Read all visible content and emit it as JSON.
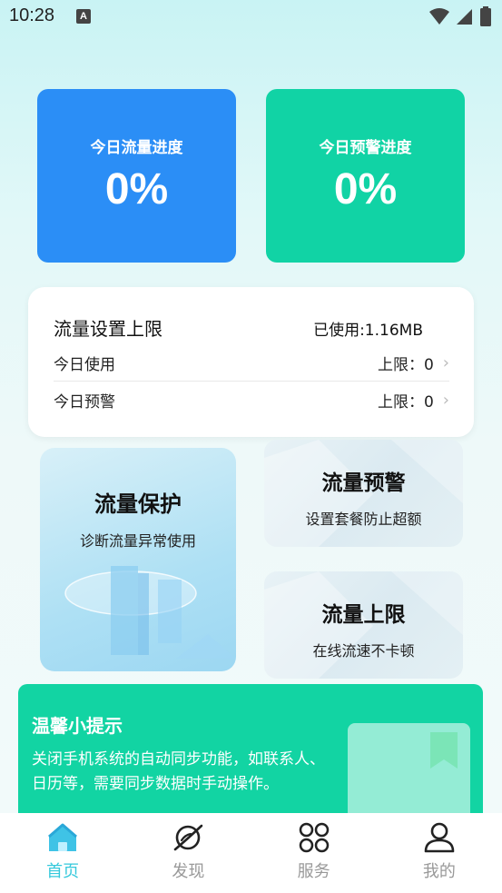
{
  "status_bar": {
    "time": "10:28",
    "notif_letter": "A"
  },
  "progress_cards": [
    {
      "title": "今日流量进度",
      "value": "0%"
    },
    {
      "title": "今日预警进度",
      "value": "0%"
    }
  ],
  "limit_panel": {
    "title": "流量设置上限",
    "used": "已使用:1.16MB",
    "rows": [
      {
        "label": "今日使用",
        "value": "上限：0"
      },
      {
        "label": "今日预警",
        "value": "上限：0"
      }
    ]
  },
  "features": {
    "protect": {
      "title": "流量保护",
      "sub": "诊断流量异常使用"
    },
    "warning": {
      "title": "流量预警",
      "sub": "设置套餐防止超额"
    },
    "limit": {
      "title": "流量上限",
      "sub": "在线流速不卡顿"
    }
  },
  "tips": {
    "title": "温馨小提示",
    "text": "关闭手机系统的自动同步功能，如联系人、日历等，需要同步数据时手动操作。"
  },
  "nav": [
    {
      "label": "首页",
      "icon": "home-icon",
      "active": true
    },
    {
      "label": "发现",
      "icon": "planet-icon",
      "active": false
    },
    {
      "label": "服务",
      "icon": "grid-icon",
      "active": false
    },
    {
      "label": "我的",
      "icon": "user-icon",
      "active": false
    }
  ],
  "colors": {
    "blue": "#2b8ef6",
    "green": "#11d3a5",
    "active_nav": "#35c9dc"
  }
}
